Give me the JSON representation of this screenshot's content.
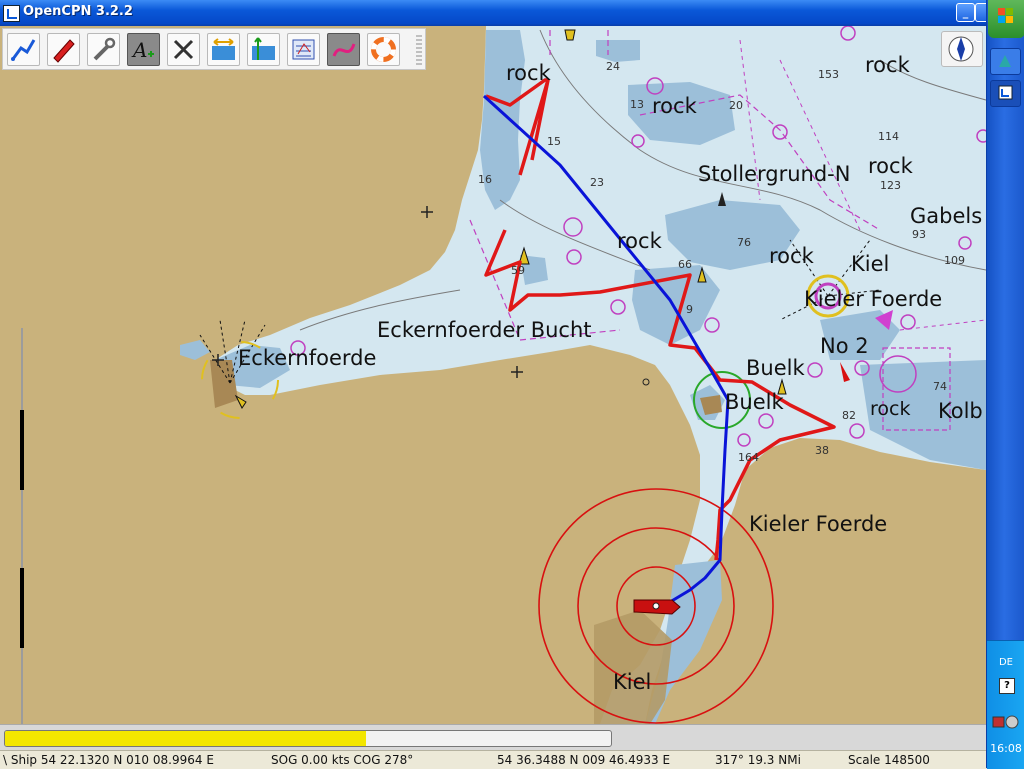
{
  "window": {
    "title": "OpenCPN 3.2.2",
    "minimize_glyph": "_"
  },
  "toolbar": {
    "buttons": [
      {
        "name": "route-icon",
        "tooltip": ""
      },
      {
        "name": "ship-icon",
        "tooltip": ""
      },
      {
        "name": "settings-wrench-icon",
        "tooltip": ""
      },
      {
        "name": "text-toggle-icon",
        "tooltip": ""
      },
      {
        "name": "light-toggle-icon",
        "tooltip": ""
      },
      {
        "name": "zoom-horizontal-icon",
        "tooltip": ""
      },
      {
        "name": "zoom-vertical-icon",
        "tooltip": ""
      },
      {
        "name": "chart-icon",
        "tooltip": ""
      },
      {
        "name": "track-icon",
        "tooltip": ""
      },
      {
        "name": "lifebuoy-icon",
        "tooltip": ""
      }
    ]
  },
  "chart": {
    "labels": {
      "rock1": "rock",
      "rock2": "rock",
      "rock3": "rock",
      "rock4": "rock",
      "rock5": "rock",
      "rock6": "rock",
      "rock7": "rock",
      "stollergrund": "Stollergrund-N",
      "gabels": "Gabels",
      "kiel_label_top": "Kiel",
      "kieler_foerde_top": "Kieler Foerde",
      "no2": "No 2",
      "eckernfoerder_bucht": "Eckernfoerder Bucht",
      "eckernfoerde": "Eckernfoerde",
      "buelk1": "Buelk",
      "buelk2": "Buelk",
      "kolb": "Kolb",
      "kieler_foerde_bottom": "Kieler Foerde",
      "kiel_city": "Kiel"
    },
    "depths": [
      "24",
      "13",
      "20",
      "153",
      "114",
      "15",
      "23",
      "123",
      "93",
      "76",
      "66",
      "109",
      "16",
      "59",
      "9",
      "74",
      "82",
      "38",
      "164"
    ],
    "colors": {
      "land": "#c9b27c",
      "deep_water": "#d4e7f0",
      "shallow_water": "#9cbfd9",
      "track": "#e01818",
      "route": "#0a14d8",
      "range_rings": "#d81010",
      "boundary": "#c040c0"
    }
  },
  "progress": {
    "fraction": 0.595
  },
  "status": {
    "ship": "\\ Ship 54 22.1320 N   010 08.9964 E",
    "sog_cog": "SOG 0.00 kts  COG 278°",
    "cursor": "54 36.3488 N   009 46.4933 E",
    "bearing": "317°  19.3 NMi",
    "scale": "Scale 148500"
  },
  "taskbar": {
    "language": "DE",
    "help_glyph": "?",
    "clock": "16:08"
  }
}
